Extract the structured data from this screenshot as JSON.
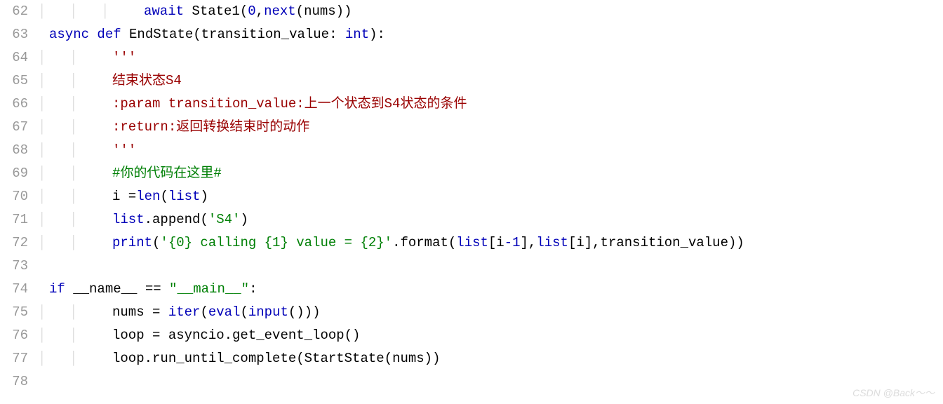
{
  "watermark": "CSDN @Back～～",
  "lines": [
    {
      "num": "62",
      "indent": 3,
      "tokens": [
        {
          "t": "await ",
          "c": "kw"
        },
        {
          "t": "State1(",
          "c": "fn"
        },
        {
          "t": "0",
          "c": "num"
        },
        {
          "t": ",",
          "c": "punct"
        },
        {
          "t": "next",
          "c": "builtin"
        },
        {
          "t": "(nums))",
          "c": "fn"
        }
      ]
    },
    {
      "num": "63",
      "indent": 0,
      "tokens": [
        {
          "t": "async ",
          "c": "kw"
        },
        {
          "t": "def ",
          "c": "kw"
        },
        {
          "t": "EndState(transition_value: ",
          "c": "fn"
        },
        {
          "t": "int",
          "c": "type"
        },
        {
          "t": "):",
          "c": "fn"
        }
      ]
    },
    {
      "num": "64",
      "indent": 2,
      "tokens": [
        {
          "t": "'''",
          "c": "docstr"
        }
      ]
    },
    {
      "num": "65",
      "indent": 2,
      "tokens": [
        {
          "t": "结束状态S4",
          "c": "docstr"
        }
      ]
    },
    {
      "num": "66",
      "indent": 2,
      "tokens": [
        {
          "t": ":param transition_value:上一个状态到S4状态的条件",
          "c": "docstr"
        }
      ]
    },
    {
      "num": "67",
      "indent": 2,
      "tokens": [
        {
          "t": ":return:返回转换结束时的动作",
          "c": "docstr"
        }
      ]
    },
    {
      "num": "68",
      "indent": 2,
      "tokens": [
        {
          "t": "'''",
          "c": "docstr"
        }
      ]
    },
    {
      "num": "69",
      "indent": 2,
      "tokens": [
        {
          "t": "#你的代码在这里#",
          "c": "comment"
        }
      ]
    },
    {
      "num": "70",
      "indent": 2,
      "tokens": [
        {
          "t": "i =",
          "c": "fn"
        },
        {
          "t": "len",
          "c": "builtin"
        },
        {
          "t": "(",
          "c": "fn"
        },
        {
          "t": "list",
          "c": "builtin"
        },
        {
          "t": ")",
          "c": "fn"
        }
      ]
    },
    {
      "num": "71",
      "indent": 2,
      "tokens": [
        {
          "t": "list",
          "c": "builtin"
        },
        {
          "t": ".append(",
          "c": "fn"
        },
        {
          "t": "'S4'",
          "c": "str"
        },
        {
          "t": ")",
          "c": "fn"
        }
      ]
    },
    {
      "num": "72",
      "indent": 2,
      "tokens": [
        {
          "t": "print",
          "c": "builtin"
        },
        {
          "t": "(",
          "c": "fn"
        },
        {
          "t": "'{0} calling {1} value = {2}'",
          "c": "str"
        },
        {
          "t": ".format(",
          "c": "fn"
        },
        {
          "t": "list",
          "c": "builtin"
        },
        {
          "t": "[i",
          "c": "fn"
        },
        {
          "t": "-1",
          "c": "num"
        },
        {
          "t": "],",
          "c": "fn"
        },
        {
          "t": "list",
          "c": "builtin"
        },
        {
          "t": "[i],transition_value))",
          "c": "fn"
        }
      ]
    },
    {
      "num": "73",
      "indent": 0,
      "tokens": []
    },
    {
      "num": "74",
      "indent": 0,
      "tokens": [
        {
          "t": "if ",
          "c": "kw"
        },
        {
          "t": "__name__ == ",
          "c": "fn"
        },
        {
          "t": "\"__main__\"",
          "c": "str"
        },
        {
          "t": ":",
          "c": "fn"
        }
      ]
    },
    {
      "num": "75",
      "indent": 2,
      "tokens": [
        {
          "t": "nums = ",
          "c": "fn"
        },
        {
          "t": "iter",
          "c": "builtin"
        },
        {
          "t": "(",
          "c": "fn"
        },
        {
          "t": "eval",
          "c": "builtin"
        },
        {
          "t": "(",
          "c": "fn"
        },
        {
          "t": "input",
          "c": "builtin"
        },
        {
          "t": "()))",
          "c": "fn"
        }
      ]
    },
    {
      "num": "76",
      "indent": 2,
      "tokens": [
        {
          "t": "loop = asyncio.get_event_loop()",
          "c": "fn"
        }
      ]
    },
    {
      "num": "77",
      "indent": 2,
      "tokens": [
        {
          "t": "loop.run_until_complete(StartState(nums))",
          "c": "fn"
        }
      ]
    },
    {
      "num": "78",
      "indent": 0,
      "tokens": []
    }
  ]
}
